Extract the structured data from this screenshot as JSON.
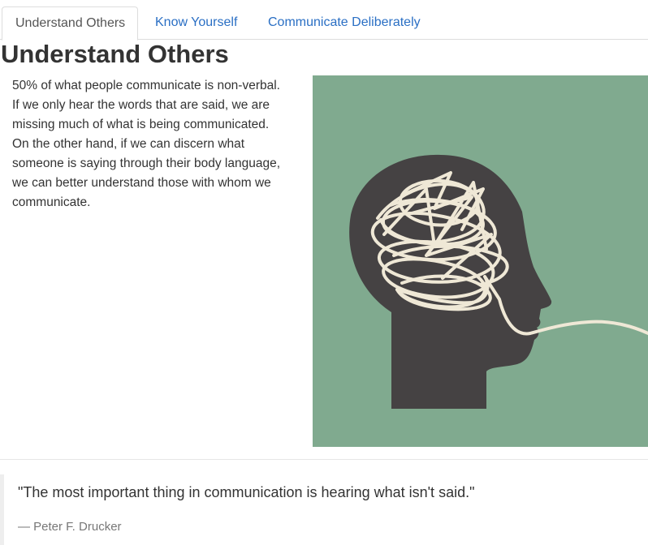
{
  "tabs": [
    {
      "label": "Understand Others",
      "active": true
    },
    {
      "label": "Know Yourself",
      "active": false
    },
    {
      "label": "Communicate Deliberately",
      "active": false
    }
  ],
  "content": {
    "title": "Understand Others",
    "paragraph": "50% of what people communicate is non-verbal. If we only hear the words that are said, we are missing much of what is being communicated. On the other hand, if we can discern what someone is saying through their body language, we can better understand those with whom we communicate.",
    "image": {
      "name": "head-silhouette-scribble-illustration",
      "background_color": "#80aa8f",
      "head_color": "#454243",
      "line_color": "#efe8d6"
    }
  },
  "quote": {
    "text": "\"The most important thing in communication is hearing what isn't said.\"",
    "author": "— Peter F. Drucker"
  },
  "colors": {
    "link": "#2a6fc4",
    "active_tab_text": "#555555",
    "text": "#333333",
    "muted": "#777777"
  }
}
